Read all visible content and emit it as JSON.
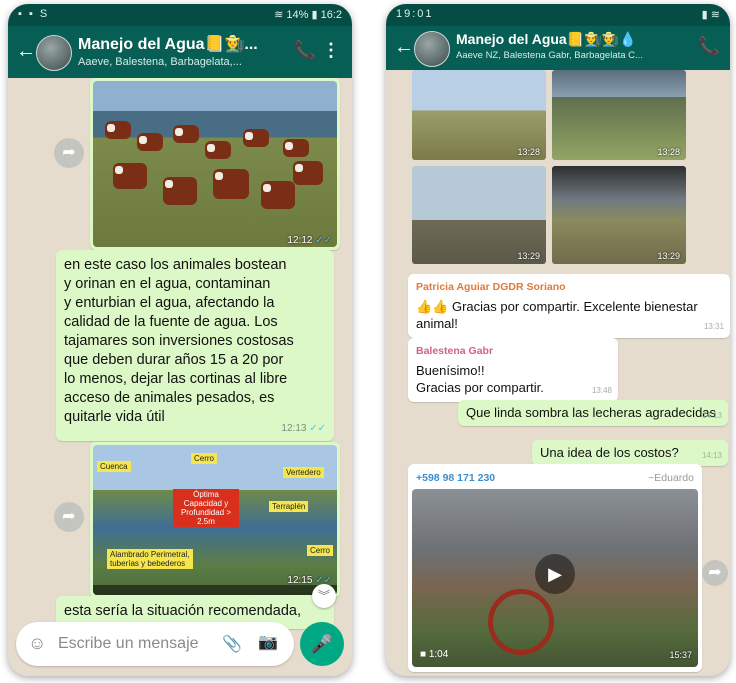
{
  "left": {
    "status": {
      "icons": "▪ ▪ S",
      "battery": "14%",
      "time": "16:2"
    },
    "header": {
      "title": "Manejo del Agua📒👨‍🌾...",
      "subtitle": "Aaeve, Balestena, Barbagelata,..."
    },
    "messages": [
      {
        "type": "image",
        "time": "12:12"
      },
      {
        "type": "text",
        "time": "12:13",
        "lines": [
          "en este caso los animales bostean",
          "y orinan en el agua, contaminan",
          "y enturbian el agua, afectando la",
          "calidad de la fuente de agua. Los",
          "tajamares son inversiones costosas",
          "que deben durar años 15 a 20 por",
          "lo menos, dejar las cortinas al libre",
          "acceso de animales pesados, es",
          "quitarle vida útil"
        ]
      },
      {
        "type": "image",
        "time": "12:15",
        "labels": {
          "cuenca": "Cuenca",
          "cerro": "Cerro",
          "vertedero": "Vertedero",
          "optima": "Óptima Capacidad y Profundidad > 2.5m",
          "terraplen": "Terraplén",
          "alambrado": "Alambrado Perimetral, tuberías y bebederos",
          "cerro2": "Cerro"
        }
      },
      {
        "type": "text",
        "text": "esta sería la situación recomendada,"
      }
    ],
    "input": {
      "placeholder": "Escribe un mensaje"
    }
  },
  "right": {
    "status": {
      "time": "19:01"
    },
    "header": {
      "title": "Manejo del Agua📒👨‍🌾👨‍🌾💧",
      "subtitle": "Aaeve NZ, Balestena Gabr, Barbagelata C..."
    },
    "photos": [
      {
        "time": "13:28"
      },
      {
        "time": "13:28"
      },
      {
        "time": "13:29"
      },
      {
        "time": "13:29"
      }
    ],
    "messages": [
      {
        "sender": "Patricia Aguiar DGDR Soriano",
        "text": "👍👍 Gracias por compartir. Excelente bienestar animal!",
        "time": "13:31"
      },
      {
        "sender": "Balestena Gabr",
        "text1": "Buenísimo!!",
        "text2": "Gracias por compartir.",
        "time": "13:48"
      },
      {
        "text": "Que linda sombra las lecheras agradecidas",
        "time": "14:13"
      },
      {
        "text": "Una idea de los costos?",
        "time": "14:13"
      },
      {
        "sender": "+598 98 171 230",
        "alias": "~Eduardo",
        "duration": "1:04",
        "time": "15:37"
      }
    ]
  }
}
